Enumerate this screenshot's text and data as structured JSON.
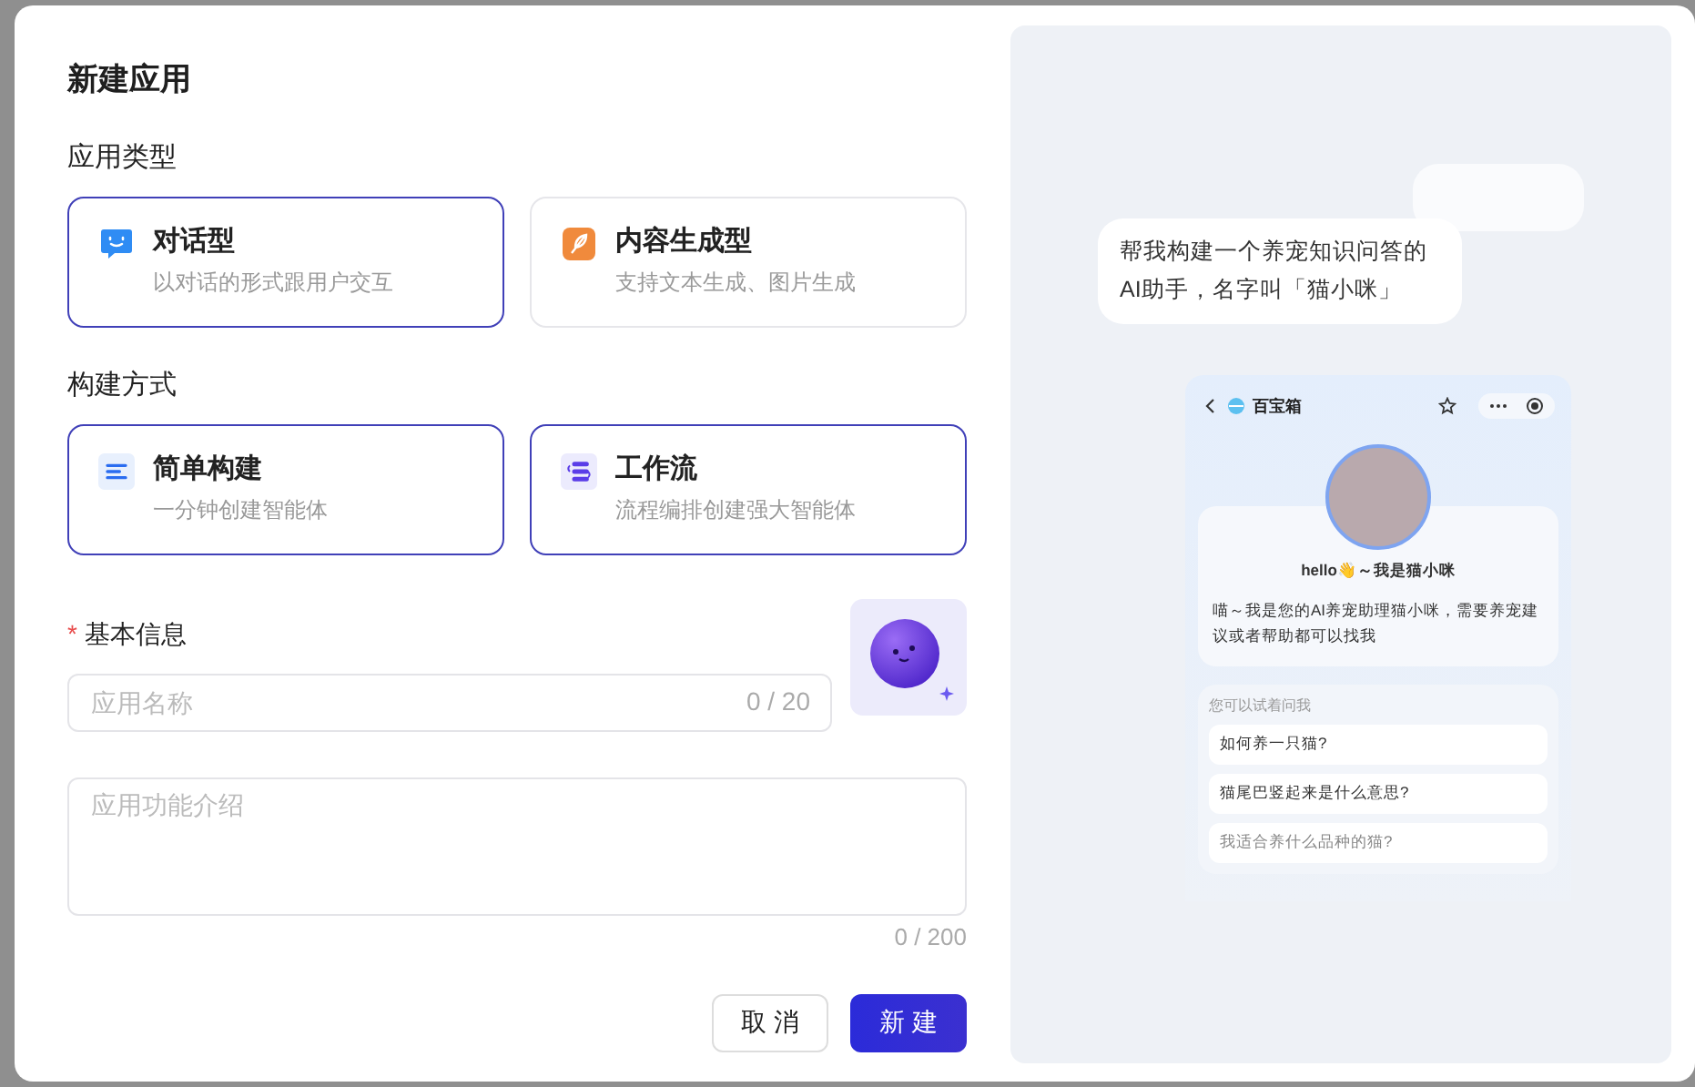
{
  "dialog": {
    "title": "新建应用"
  },
  "app_type": {
    "label": "应用类型",
    "options": [
      {
        "title": "对话型",
        "description": "以对话的形式跟用户交互",
        "selected": true
      },
      {
        "title": "内容生成型",
        "description": "支持文本生成、图片生成",
        "selected": false
      }
    ]
  },
  "build_method": {
    "label": "构建方式",
    "options": [
      {
        "title": "简单构建",
        "description": "一分钟创建智能体",
        "selected": true
      },
      {
        "title": "工作流",
        "description": "流程编排创建强大智能体",
        "selected": true
      }
    ]
  },
  "basic_info": {
    "label": "基本信息",
    "required_mark": "*",
    "name_field": {
      "placeholder": "应用名称",
      "counter": "0 / 20"
    },
    "description_field": {
      "placeholder": "应用功能介绍",
      "counter": "0 / 200"
    }
  },
  "buttons": [
    {
      "label": "取 消",
      "kind": "secondary"
    },
    {
      "label": "新 建",
      "kind": "primary"
    }
  ],
  "preview": {
    "prompt": "帮我构建一个养宠知识问答的AI助手，名字叫「猫小咪」",
    "phone": {
      "app_name": "百宝箱",
      "greeting": "hello👋～我是猫小咪",
      "intro": "喵～我是您的AI养宠助理猫小咪，需要养宠建议或者帮助都可以找我",
      "suggest_label": "您可以试着问我",
      "suggestions": [
        "如何养一只猫?",
        "猫尾巴竖起来是什么意思?",
        "我适合养什么品种的猫?"
      ]
    }
  }
}
